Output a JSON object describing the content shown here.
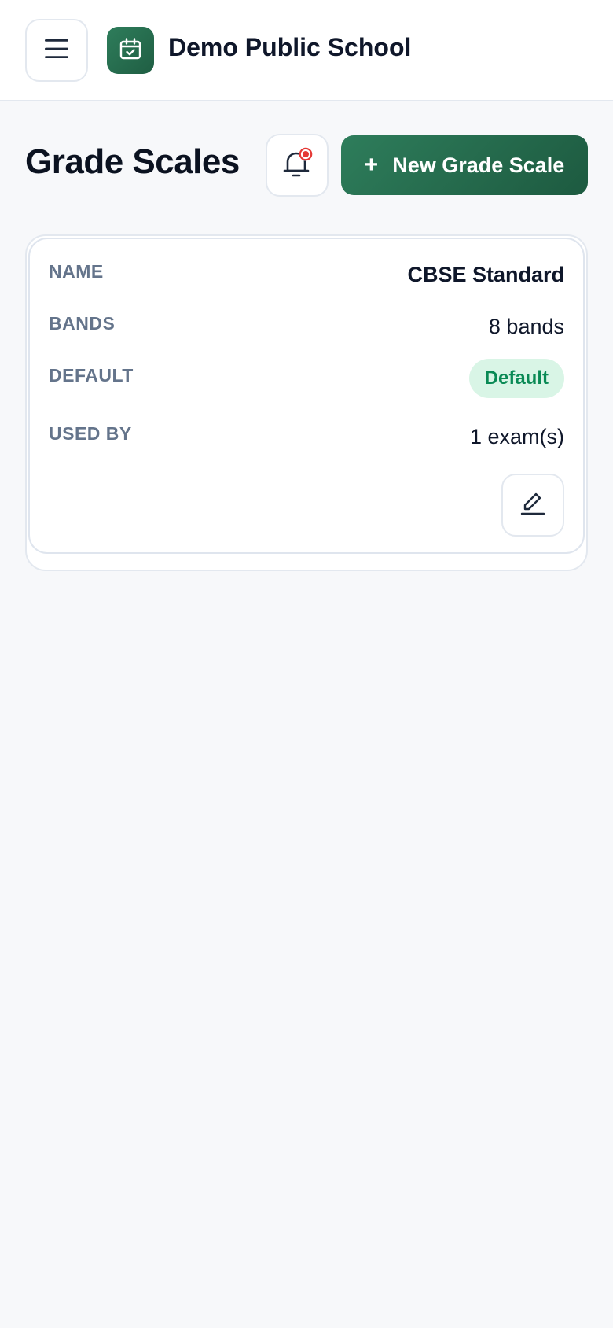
{
  "header": {
    "menu_icon": "menu-icon",
    "logo_icon": "calendar-check-icon",
    "app_name": "Demo Public School"
  },
  "page": {
    "title": "Grade Scales",
    "bell_icon": "bell-icon",
    "new_button_icon": "plus-icon",
    "new_button_plus": "+",
    "new_button_label": "New Grade Scale"
  },
  "grade_scale": {
    "name_label": "NAME",
    "name_value": "CBSE Standard",
    "bands_label": "BANDS",
    "bands_value": "8 bands",
    "default_label": "DEFAULT",
    "default_value": "Default",
    "used_by_label": "USED BY",
    "used_by_value": "1 exam(s)",
    "edit_icon": "pencil-icon"
  },
  "colors": {
    "brand": "#2e7d5b",
    "badge_bg": "#d9f5e6",
    "badge_text": "#0a8a55",
    "notification_dot": "#e53935",
    "page_bg": "#f7f8fa"
  }
}
